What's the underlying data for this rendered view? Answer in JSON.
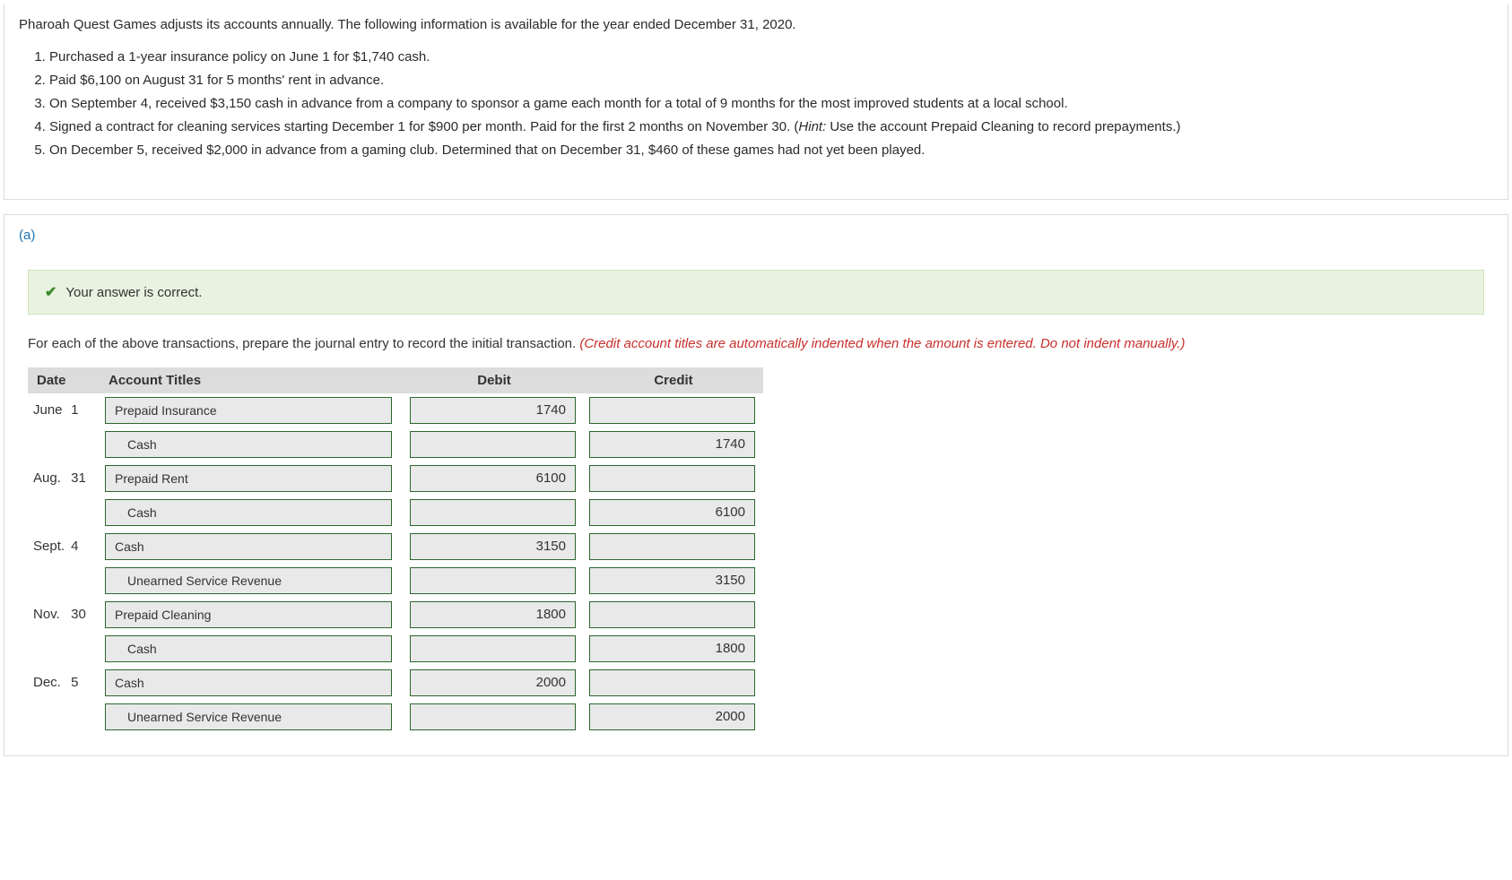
{
  "intro": {
    "lead": "Pharoah Quest Games adjusts its accounts annually. The following information is available for the year ended December 31, 2020.",
    "items": [
      "Purchased a 1-year insurance policy on June 1 for $1,740 cash.",
      "Paid $6,100 on August 31 for 5 months' rent in advance.",
      "On September 4, received $3,150 cash in advance from a company to sponsor a game each month for a total of 9 months for the most improved students at a local school.",
      "Signed a contract for cleaning services starting December 1 for $900 per month. Paid for the first 2 months on November 30. (",
      "On December 5, received $2,000 in advance from a gaming club. Determined that on December 31, $460 of these games had not yet been played."
    ],
    "item4_hint_label": "Hint:",
    "item4_hint_text": " Use the account Prepaid Cleaning to record prepayments.)"
  },
  "part": {
    "label": "(a)",
    "feedback": "Your answer is correct.",
    "instruction_plain": "For each of the above transactions, prepare the journal entry to record the initial transaction. ",
    "instruction_red": "(Credit account titles are automatically indented when the amount is entered. Do not indent manually.)"
  },
  "headers": {
    "date": "Date",
    "account": "Account Titles",
    "debit": "Debit",
    "credit": "Credit"
  },
  "rows": [
    {
      "month": "June",
      "day": "1",
      "account": "Prepaid Insurance",
      "indent": false,
      "debit": "1740",
      "credit": ""
    },
    {
      "month": "",
      "day": "",
      "account": "Cash",
      "indent": true,
      "debit": "",
      "credit": "1740"
    },
    {
      "month": "Aug.",
      "day": "31",
      "account": "Prepaid Rent",
      "indent": false,
      "debit": "6100",
      "credit": ""
    },
    {
      "month": "",
      "day": "",
      "account": "Cash",
      "indent": true,
      "debit": "",
      "credit": "6100"
    },
    {
      "month": "Sept.",
      "day": "4",
      "account": "Cash",
      "indent": false,
      "debit": "3150",
      "credit": ""
    },
    {
      "month": "",
      "day": "",
      "account": "Unearned Service Revenue",
      "indent": true,
      "debit": "",
      "credit": "3150"
    },
    {
      "month": "Nov.",
      "day": "30",
      "account": "Prepaid Cleaning",
      "indent": false,
      "debit": "1800",
      "credit": ""
    },
    {
      "month": "",
      "day": "",
      "account": "Cash",
      "indent": true,
      "debit": "",
      "credit": "1800"
    },
    {
      "month": "Dec.",
      "day": "5",
      "account": "Cash",
      "indent": false,
      "debit": "2000",
      "credit": ""
    },
    {
      "month": "",
      "day": "",
      "account": "Unearned Service Revenue",
      "indent": true,
      "debit": "",
      "credit": "2000"
    }
  ]
}
